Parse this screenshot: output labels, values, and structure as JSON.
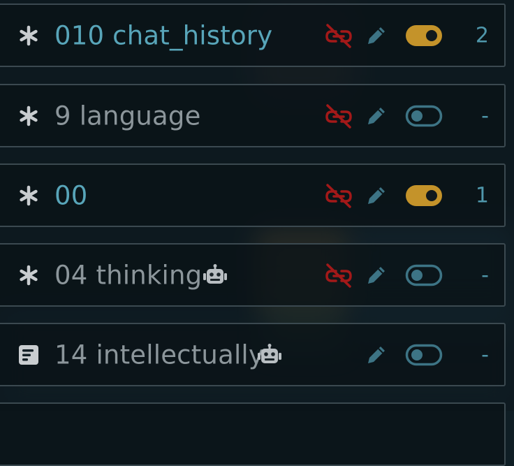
{
  "colors": {
    "active_text": "#58a5b9",
    "inactive_text": "#8c969b",
    "unlink_icon": "#a31919",
    "pencil_icon": "#3d7485",
    "toggle_on": "#c4932a",
    "toggle_off": "#3d7485"
  },
  "entries": [
    {
      "title": "010 chat_history",
      "lead_icon": "asterisk-icon",
      "active": true,
      "bot": false,
      "unlink": true,
      "toggle_on": true,
      "count": "2"
    },
    {
      "title": "9 language",
      "lead_icon": "asterisk-icon",
      "active": false,
      "bot": false,
      "unlink": true,
      "toggle_on": false,
      "count": "-"
    },
    {
      "title": "00",
      "lead_icon": "asterisk-icon",
      "active": true,
      "bot": false,
      "unlink": true,
      "toggle_on": true,
      "count": "1"
    },
    {
      "title": "04 thinking",
      "lead_icon": "asterisk-icon",
      "active": false,
      "bot": true,
      "unlink": true,
      "toggle_on": false,
      "count": "-"
    },
    {
      "title": "14 intellectually",
      "lead_icon": "note-icon",
      "active": false,
      "bot": true,
      "unlink": false,
      "toggle_on": false,
      "count": "-"
    }
  ]
}
